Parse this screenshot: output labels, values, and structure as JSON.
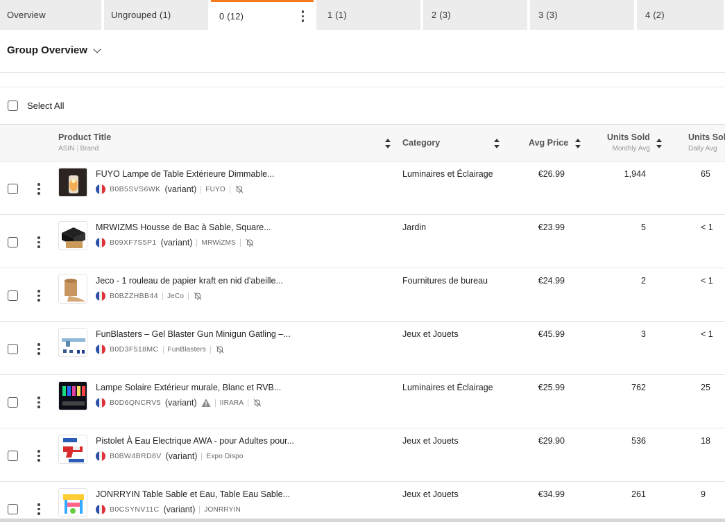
{
  "tabs": [
    {
      "label": "Overview",
      "active": false
    },
    {
      "label": "Ungrouped  (1)",
      "active": false
    },
    {
      "label": "0  (12)",
      "active": true
    },
    {
      "label": "1  (1)",
      "active": false
    },
    {
      "label": "2  (3)",
      "active": false
    },
    {
      "label": "3  (3)",
      "active": false
    },
    {
      "label": "4  (2)",
      "active": false
    }
  ],
  "group": {
    "title": "Group Overview"
  },
  "select_all_label": "Select All",
  "columns": {
    "product": {
      "title": "Product Title",
      "sub_asin": "ASIN",
      "sub_brand": "Brand"
    },
    "category": {
      "title": "Category"
    },
    "avg_price": {
      "title": "Avg Price"
    },
    "units_sold": {
      "title": "Units Sold",
      "sub": "Monthly Avg"
    },
    "units_sold_daily": {
      "title": "Units Sold",
      "sub": "Daily Avg"
    }
  },
  "rows": [
    {
      "title": "FUYO Lampe de Table Extérieure Dimmable...",
      "asin": "B0B5SVS6WK",
      "variant": "(variant)",
      "brand": "FUYO",
      "category": "Luminaires et Éclairage",
      "price": "€26.99",
      "units": "1,944",
      "daily": "65",
      "warning": false,
      "bell": true
    },
    {
      "title": "MRWIZMS Housse de Bac à Sable, Square...",
      "asin": "B09XF7S5P1",
      "variant": "(variant)",
      "brand": "MRWiZMS",
      "category": "Jardin",
      "price": "€23.99",
      "units": "5",
      "daily": "< 1",
      "warning": false,
      "bell": true
    },
    {
      "title": "Jeco - 1 rouleau de papier kraft en nid d'abeille...",
      "asin": "B0BZZHBB44",
      "variant": "",
      "brand": "JeCo",
      "category": "Fournitures de bureau",
      "price": "€24.99",
      "units": "2",
      "daily": "< 1",
      "warning": false,
      "bell": true
    },
    {
      "title": "FunBlasters – Gel Blaster Gun Minigun Gatling –...",
      "asin": "B0D3F518MC",
      "variant": "",
      "brand": "FunBlasters",
      "category": "Jeux et Jouets",
      "price": "€45.99",
      "units": "3",
      "daily": "< 1",
      "warning": false,
      "bell": true
    },
    {
      "title": "Lampe Solaire Extérieur murale, Blanc et RVB...",
      "asin": "B0D6QNCRV5",
      "variant": "(variant)",
      "brand": "IIRARA",
      "category": "Luminaires et Éclairage",
      "price": "€25.99",
      "units": "762",
      "daily": "25",
      "warning": true,
      "bell": true
    },
    {
      "title": "Pistolet À Eau Electrique AWA - pour Adultes pour...",
      "asin": "B0BW4BRD8V",
      "variant": "(variant)",
      "brand": "Expo Dispo",
      "category": "Jeux et Jouets",
      "price": "€29.90",
      "units": "536",
      "daily": "18",
      "warning": false,
      "bell": false
    },
    {
      "title": "JONRRYIN Table Sable et Eau, Table Eau Sable...",
      "asin": "B0CSYNV11C",
      "variant": "(variant)",
      "brand": "JONRRYIN",
      "category": "Jeux et Jouets",
      "price": "€34.99",
      "units": "261",
      "daily": "9",
      "warning": false,
      "bell": false
    }
  ]
}
